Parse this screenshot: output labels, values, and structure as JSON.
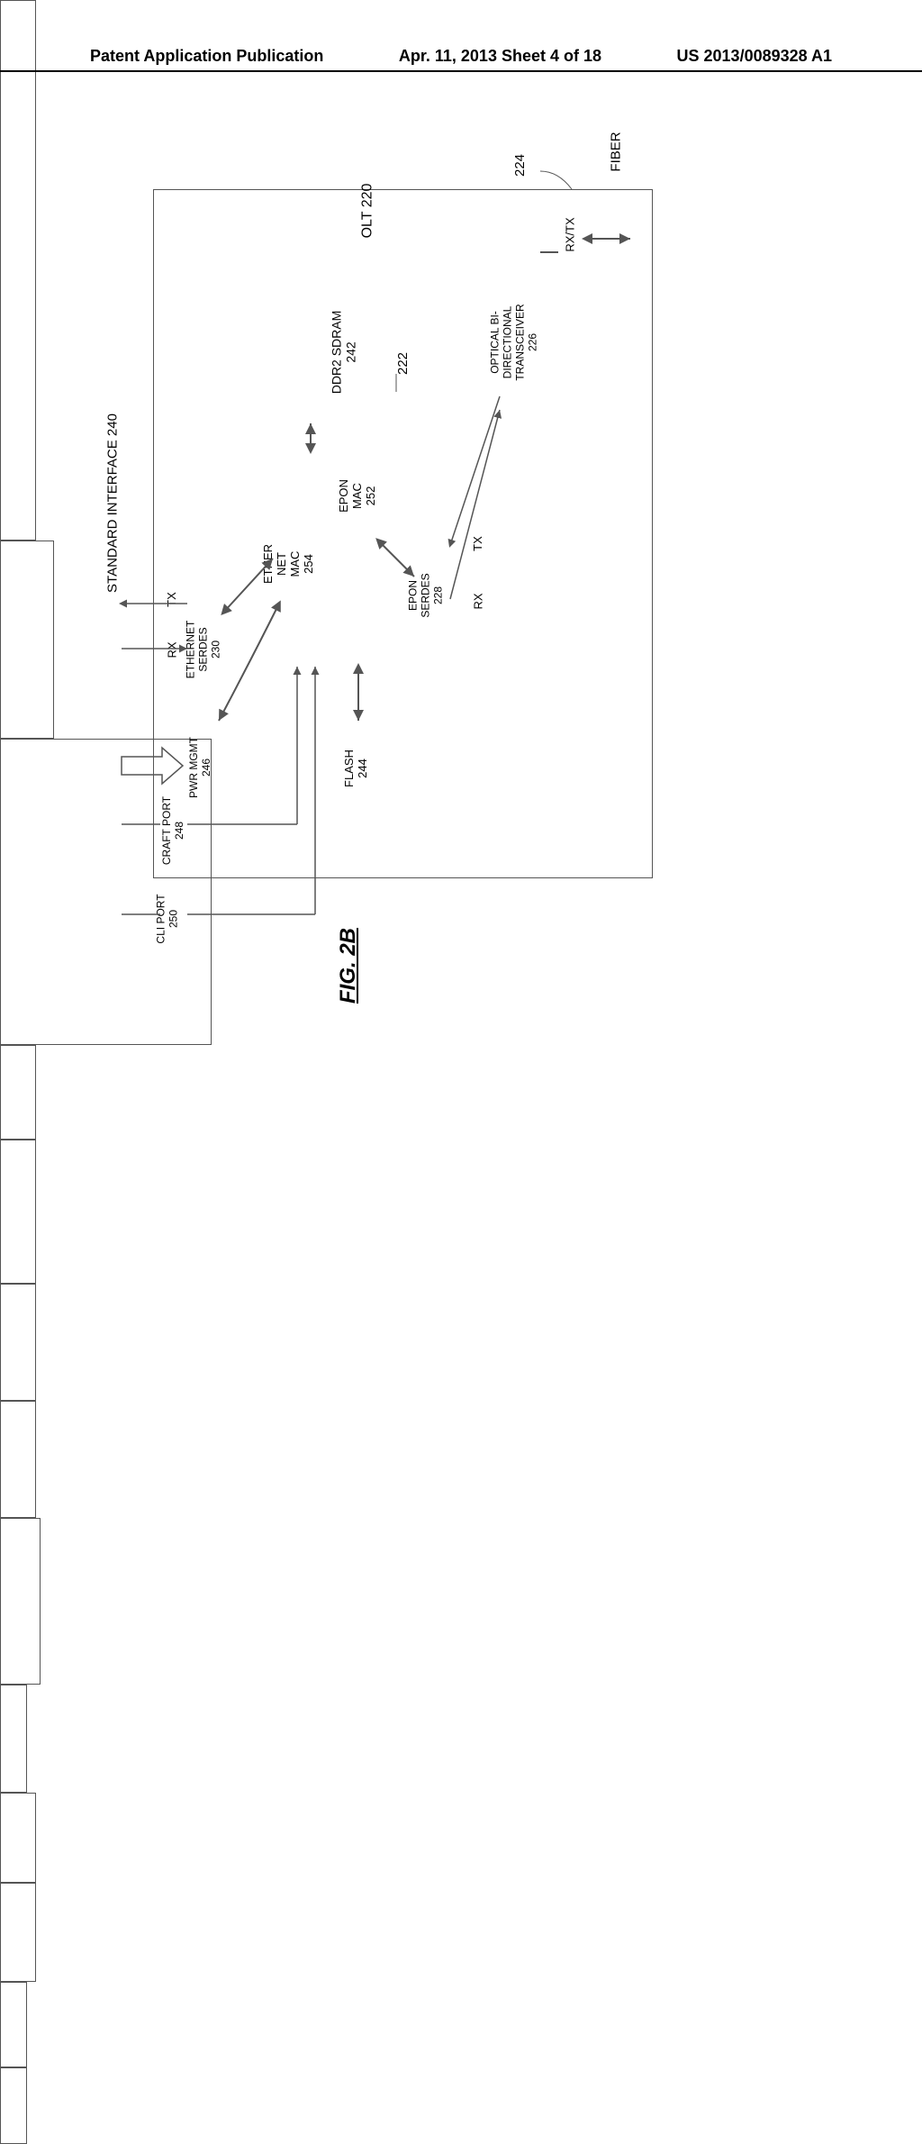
{
  "header": {
    "left": "Patent Application Publication",
    "center": "Apr. 11, 2013  Sheet 4 of 18",
    "right": "US 2013/0089328 A1"
  },
  "figure": {
    "label": "FIG. 2B",
    "olt_label": "OLT 220",
    "ref_222": "222",
    "ref_224": "224",
    "fiber": "FIBER",
    "rxtx": "RX/TX",
    "optical": "OPTICAL BI-\nDIRECTIONAL\nTRANSCEIVER\n226",
    "epon_serdes": "EPON\nSERDES\n228",
    "eth_serdes": "ETHERNET\nSERDES\n230",
    "std_interface": "STANDARD INTERFACE 240",
    "ddr2": "DDR2 SDRAM\n242",
    "flash": "FLASH\n244",
    "pwr": "PWR MGMT\n246",
    "craft": "CRAFT PORT\n248",
    "cli": "CLI PORT\n250",
    "epon_mac": "EPON\nMAC\n252",
    "eth_mac": "ETHER\nNET\nMAC\n254",
    "tx": "TX",
    "rx": "RX"
  }
}
